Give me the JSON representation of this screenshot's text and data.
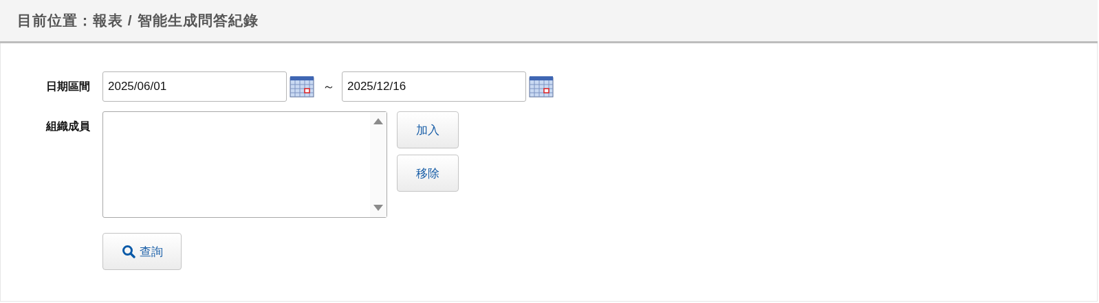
{
  "header": {
    "title": "目前位置：報表 / 智能生成問答紀錄"
  },
  "form": {
    "date_range": {
      "label": "日期區間",
      "start": "2025/06/01",
      "separator": "～",
      "end": "2025/12/16"
    },
    "members": {
      "label": "組織成員",
      "buttons": [
        "加入",
        "移除"
      ]
    },
    "search_button": {
      "label": "查詢"
    }
  }
}
